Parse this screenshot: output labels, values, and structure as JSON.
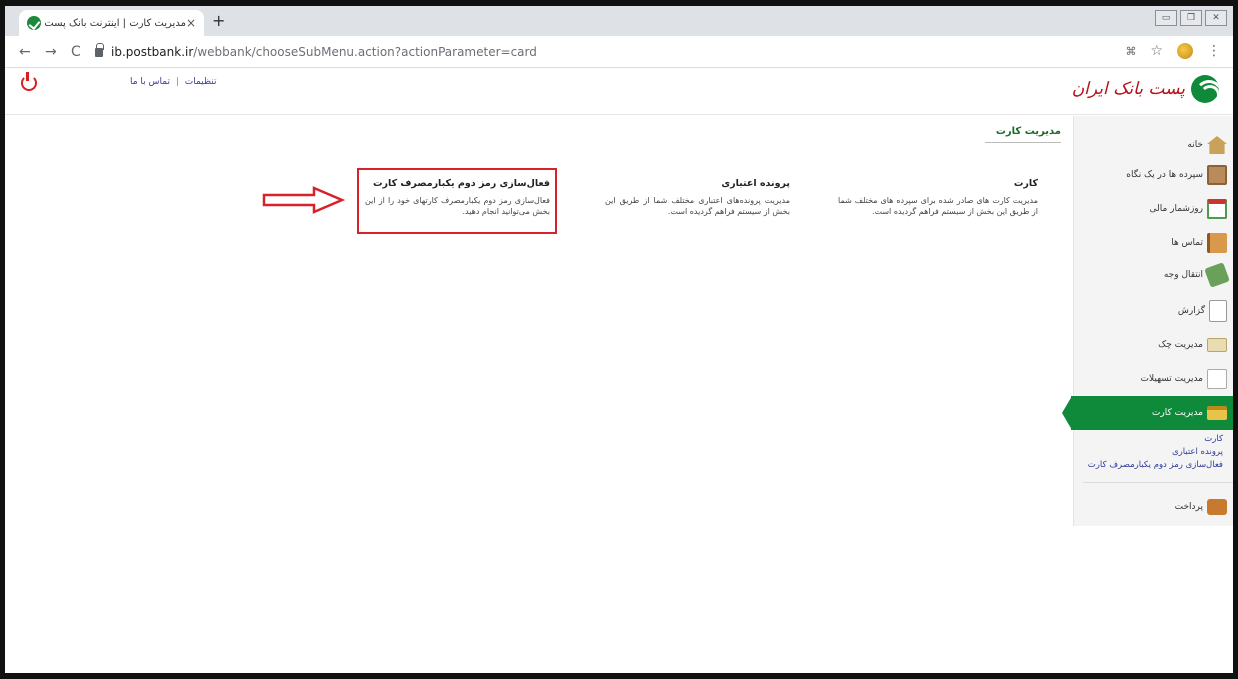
{
  "browser": {
    "tab_title": "مدیریت کارت | اینترنت بانک پست بانک",
    "tab_close": "×",
    "new_tab": "+",
    "url_host": "ib.postbank.ir",
    "url_path": "/webbank/chooseSubMenu.action?actionParameter=card",
    "back": "←",
    "forward": "→",
    "reload": "C",
    "star": "☆",
    "menu": "⋮",
    "window_buttons": [
      "▭",
      "❐",
      "✕"
    ]
  },
  "header": {
    "settings_link": "تنظیمات",
    "separator": "|",
    "contact_link": "تماس با ما",
    "brand_text": "پست بانک ایران"
  },
  "sidebar": {
    "items": [
      {
        "label": "خانه",
        "icon": "home-icon",
        "color": "#c9a25a"
      },
      {
        "label": "سپرده ها در یک نگاه",
        "icon": "deposit-icon",
        "color": "#b98b5c"
      },
      {
        "label": "روزشمار مالی",
        "icon": "calendar-icon",
        "color": "#4c9a4c"
      },
      {
        "label": "تماس ها",
        "icon": "contacts-icon",
        "color": "#d89a4a"
      },
      {
        "label": "انتقال وجه",
        "icon": "transfer-icon",
        "color": "#6aa05a"
      },
      {
        "label": "گزارش",
        "icon": "report-icon",
        "color": "#e3e3e3"
      },
      {
        "label": "مدیریت چک",
        "icon": "cheque-icon",
        "color": "#e8dcb0"
      },
      {
        "label": "مدیریت تسهیلات",
        "icon": "loan-icon",
        "color": "#d5d5d5"
      },
      {
        "label": "مدیریت کارت",
        "icon": "card-icon",
        "color": "#e9c24a"
      },
      {
        "label": "پرداخت",
        "icon": "wallet-icon",
        "color": "#c77a2e"
      }
    ],
    "submenu": [
      "کارت",
      "پرونده اعتباری",
      "فعال‌سازی رمز دوم یکبارمصرف کارت"
    ]
  },
  "main": {
    "breadcrumb": "مدیریت کارت",
    "cards": [
      {
        "title": "کارت",
        "desc": "مدیریت کارت های صادر شده برای سپرده های مختلف شما از طریق این بخش از سیستم فراهم گردیده است."
      },
      {
        "title": "پرونده اعتباری",
        "desc": "مدیریت پرونده‌های اعتباری مختلف شما از طریق این بخش از سیستم فراهم گردیده است."
      },
      {
        "title": "فعال‌سازی رمز دوم یکبارمصرف کارت",
        "desc": "فعال‌سازی رمز دوم یکبارمصرف کارتهای خود را از این بخش می‌توانید انجام دهید."
      }
    ]
  },
  "colors": {
    "accent": "#0f8a3a",
    "highlight": "#d6232b"
  }
}
